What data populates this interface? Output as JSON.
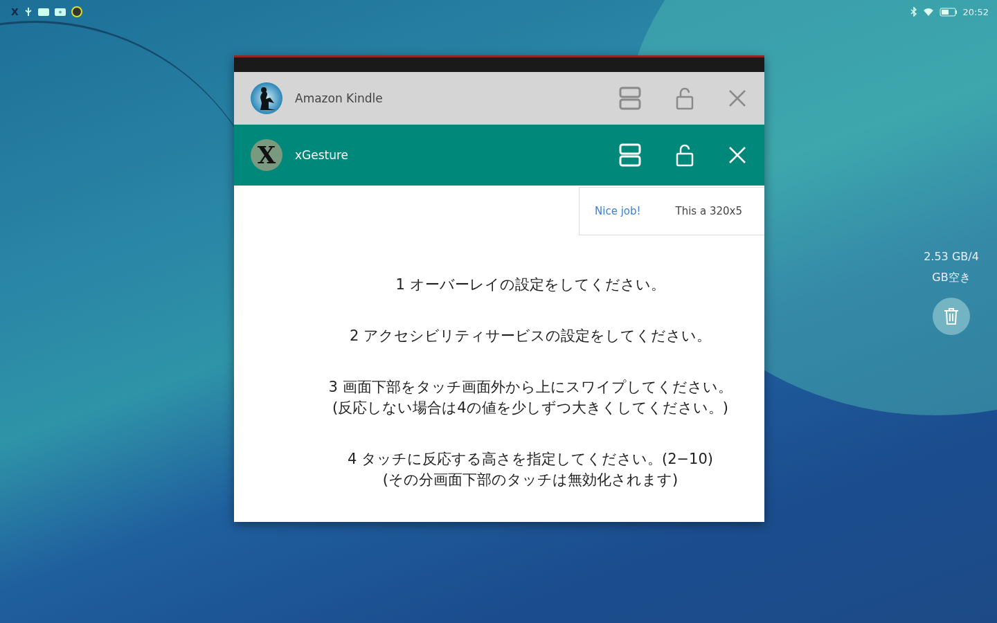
{
  "status_bar": {
    "app_letter": "X",
    "time": "20:52"
  },
  "windows": [
    {
      "title": "Amazon Kindle",
      "kind": "kindle",
      "selected": false
    },
    {
      "title": "xGesture",
      "kind": "xgesture",
      "icon_letter": "X",
      "selected": true
    }
  ],
  "ad": {
    "link": "Nice job!",
    "text": "This a 320x5"
  },
  "instructions": [
    {
      "lines": [
        "1 オーバーレイの設定をしてください。"
      ]
    },
    {
      "lines": [
        "2 アクセシビリティサービスの設定をしてください。"
      ]
    },
    {
      "lines": [
        "3 画面下部をタッチ画面外から上にスワイプしてください。",
        "(反応しない場合は4の値を少しずつ大きくしてください。)"
      ]
    },
    {
      "lines": [
        "4 タッチに反応する高さを指定してください。(2−10)",
        "(その分画面下部のタッチは無効化されます)"
      ]
    }
  ],
  "memory": {
    "lines": [
      "2.53 GB/4",
      "GB空き"
    ]
  }
}
